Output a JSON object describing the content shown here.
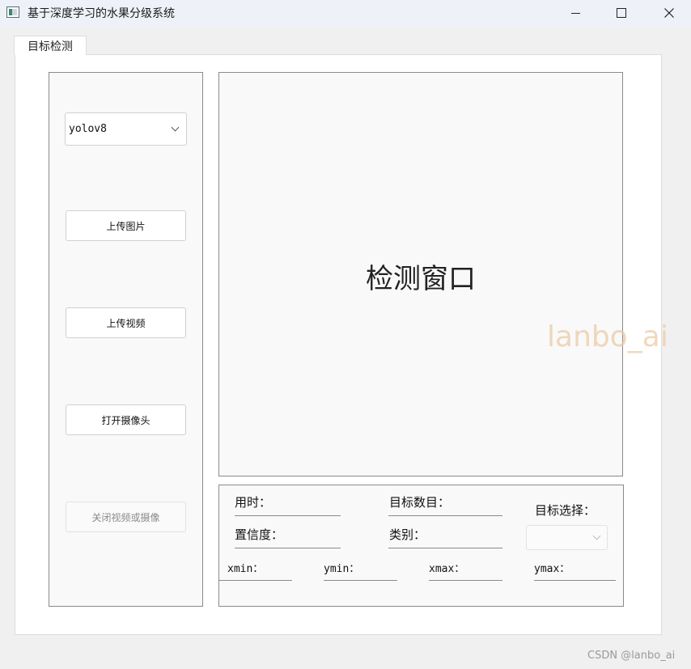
{
  "window": {
    "title": "基于深度学习的水果分级系统"
  },
  "tabs": [
    {
      "label": "目标检测",
      "selected": true
    }
  ],
  "left_panel": {
    "model_select": {
      "value": "yolov8"
    },
    "buttons": {
      "upload_image": "上传图片",
      "upload_video": "上传视频",
      "open_camera": "打开摄像头",
      "close_video_camera": "关闭视频或摄像"
    }
  },
  "display": {
    "label": "检测窗口"
  },
  "info": {
    "time_label": "用时：",
    "target_count_label": "目标数目：",
    "target_select_label": "目标选择：",
    "confidence_label": "置信度：",
    "class_label": "类别：",
    "xmin_label": "xmin：",
    "ymin_label": "ymin：",
    "xmax_label": "xmax：",
    "ymax_label": "ymax："
  },
  "watermarks": {
    "overlay": "lanbo_ai",
    "footer": "CSDN @lanbo_ai"
  },
  "colors": {
    "panel_border": "#8a8a8a",
    "watermark": "#ebc8a0"
  }
}
